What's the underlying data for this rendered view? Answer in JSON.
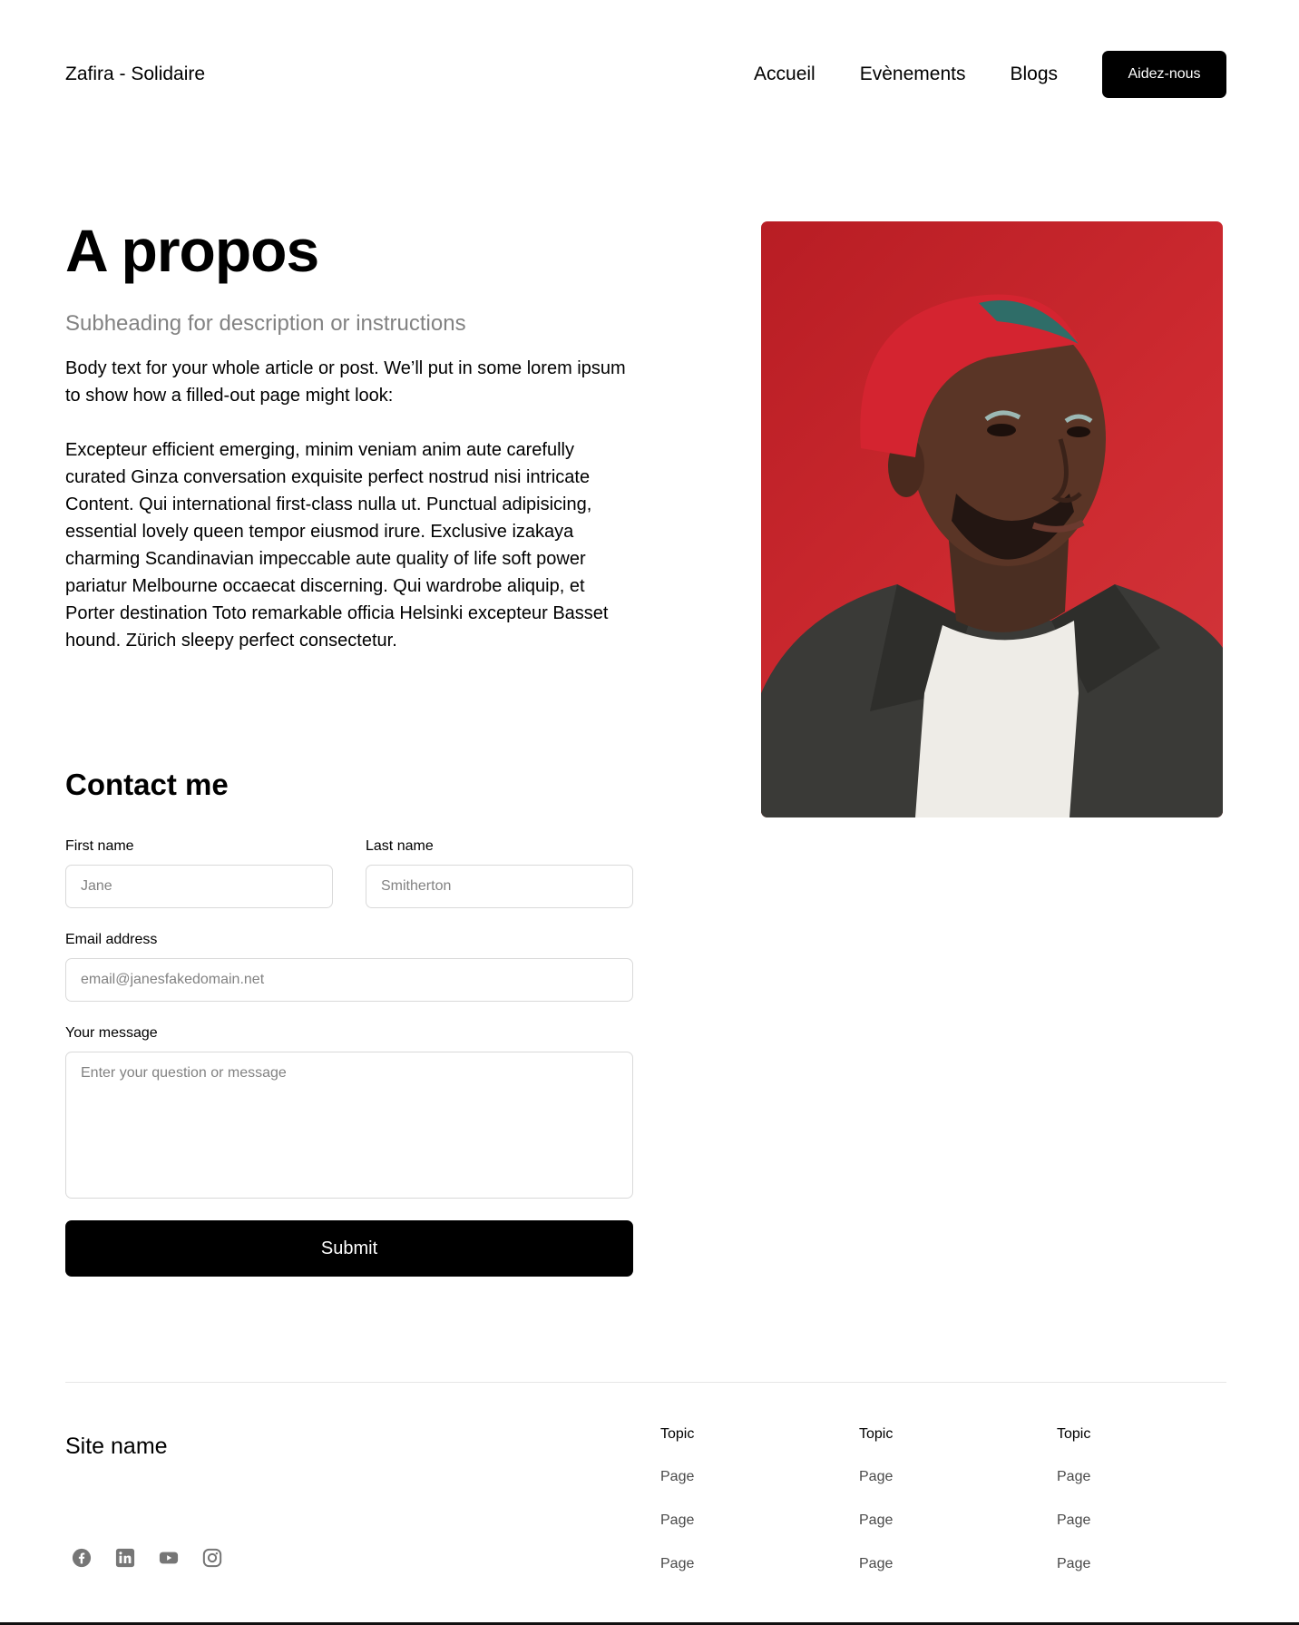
{
  "header": {
    "brand": "Zafira - Solidaire",
    "nav": [
      "Accueil",
      "Evènements",
      "Blogs"
    ],
    "cta": "Aidez-nous"
  },
  "article": {
    "title": "A propos",
    "subtitle": "Subheading for description or instructions",
    "paragraphs": [
      "Body text for your whole article or post. We’ll put in some lorem ipsum to show how a filled-out page might look:",
      "Excepteur efficient emerging, minim veniam anim aute carefully curated Ginza conversation exquisite perfect nostrud nisi intricate Content. Qui  international first-class nulla ut. Punctual adipisicing, essential lovely queen tempor eiusmod irure. Exclusive izakaya charming Scandinavian impeccable aute quality of life soft power pariatur Melbourne occaecat discerning. Qui wardrobe aliquip, et Porter destination Toto remarkable officia Helsinki excepteur Basset hound. Zürich sleepy perfect consectetur."
    ]
  },
  "contact": {
    "heading": "Contact me",
    "first_name": {
      "label": "First name",
      "placeholder": "Jane"
    },
    "last_name": {
      "label": "Last name",
      "placeholder": "Smitherton"
    },
    "email": {
      "label": "Email address",
      "placeholder": "email@janesfakedomain.net"
    },
    "message": {
      "label": "Your message",
      "placeholder": "Enter your question or message"
    },
    "submit": "Submit"
  },
  "footer": {
    "site_name": "Site name",
    "socials": [
      "facebook-icon",
      "linkedin-icon",
      "youtube-icon",
      "instagram-icon"
    ],
    "columns": [
      {
        "topic": "Topic",
        "pages": [
          "Page",
          "Page",
          "Page"
        ]
      },
      {
        "topic": "Topic",
        "pages": [
          "Page",
          "Page",
          "Page"
        ]
      },
      {
        "topic": "Topic",
        "pages": [
          "Page",
          "Page",
          "Page"
        ]
      }
    ]
  },
  "colors": {
    "accent": "#000000",
    "portrait_background": "#c8242b",
    "muted_text": "#828282",
    "icon_gray": "#767676"
  }
}
